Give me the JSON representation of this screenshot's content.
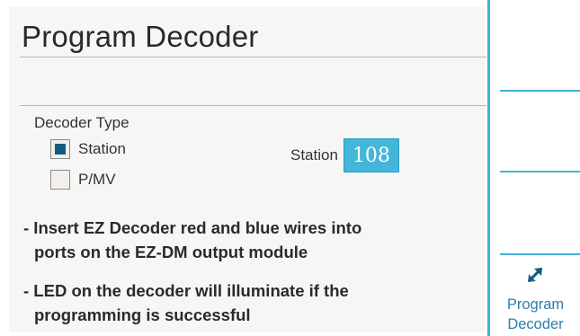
{
  "page": {
    "title": "Program Decoder"
  },
  "decoder_type": {
    "label": "Decoder Type",
    "options": [
      {
        "label": "Station",
        "checked": true
      },
      {
        "label": "P/MV",
        "checked": false
      }
    ]
  },
  "station": {
    "label": "Station",
    "value": "108"
  },
  "instructions": [
    {
      "line1": "- Insert EZ Decoder red and blue wires into",
      "line2": "ports on the EZ-DM output module"
    },
    {
      "line1": "- LED on the decoder will illuminate if the",
      "line2": "programming is successful"
    }
  ],
  "softkeys": {
    "program_decoder": {
      "line1": "Program",
      "line2": "Decoder",
      "icon": "double-arrow-icon"
    }
  },
  "colors": {
    "accent": "#3fb3d6",
    "field_bg": "#44b6d9",
    "checkbox_mark": "#0f5d80",
    "softkey_text": "#2b7fa8"
  }
}
